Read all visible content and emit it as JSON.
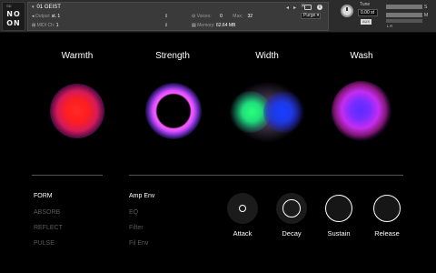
{
  "logo": {
    "small": "SD",
    "line1": "NO",
    "line2": "ON"
  },
  "instrument": {
    "name": "01 GEIST",
    "nav_prev": "◂",
    "nav_next": "▸",
    "output_label": "Output:",
    "output_value": "st. 1",
    "midi_label": "MIDI Ch:",
    "midi_value": "1",
    "voices_label": "Voices:",
    "voices_value": "0",
    "max_label": "Max:",
    "max_value": "32",
    "memory_label": "Memory:",
    "memory_value": "62.64 MB",
    "purge_label": "Purge",
    "close_glyph": "✕"
  },
  "side": {
    "tune_label": "Tune",
    "tune_value": "0.00",
    "tune_unit": "st",
    "aux_label": "AUX",
    "lr_label": "L  R",
    "pv_a": "S",
    "pv_b": "M"
  },
  "macros": [
    {
      "label": "Warmth",
      "color": "#ff2a2a"
    },
    {
      "label": "Strength",
      "color": "#d54dff"
    },
    {
      "label": "Width",
      "colors": [
        "#2cff7c",
        "#1a3cff"
      ]
    },
    {
      "label": "Wash",
      "color": "#a52cf0"
    }
  ],
  "modes": [
    {
      "label": "FORM",
      "active": true
    },
    {
      "label": "ABSORB",
      "active": false
    },
    {
      "label": "REFLECT",
      "active": false
    },
    {
      "label": "PULSE",
      "active": false
    }
  ],
  "targets": [
    {
      "label": "Amp Env",
      "active": true
    },
    {
      "label": "EQ",
      "active": false
    },
    {
      "label": "Filter",
      "active": false
    },
    {
      "label": "Fil Env",
      "active": false
    }
  ],
  "envelope": {
    "attack_label": "Attack",
    "decay_label": "Decay",
    "sustain_label": "Sustain",
    "release_label": "Release"
  }
}
